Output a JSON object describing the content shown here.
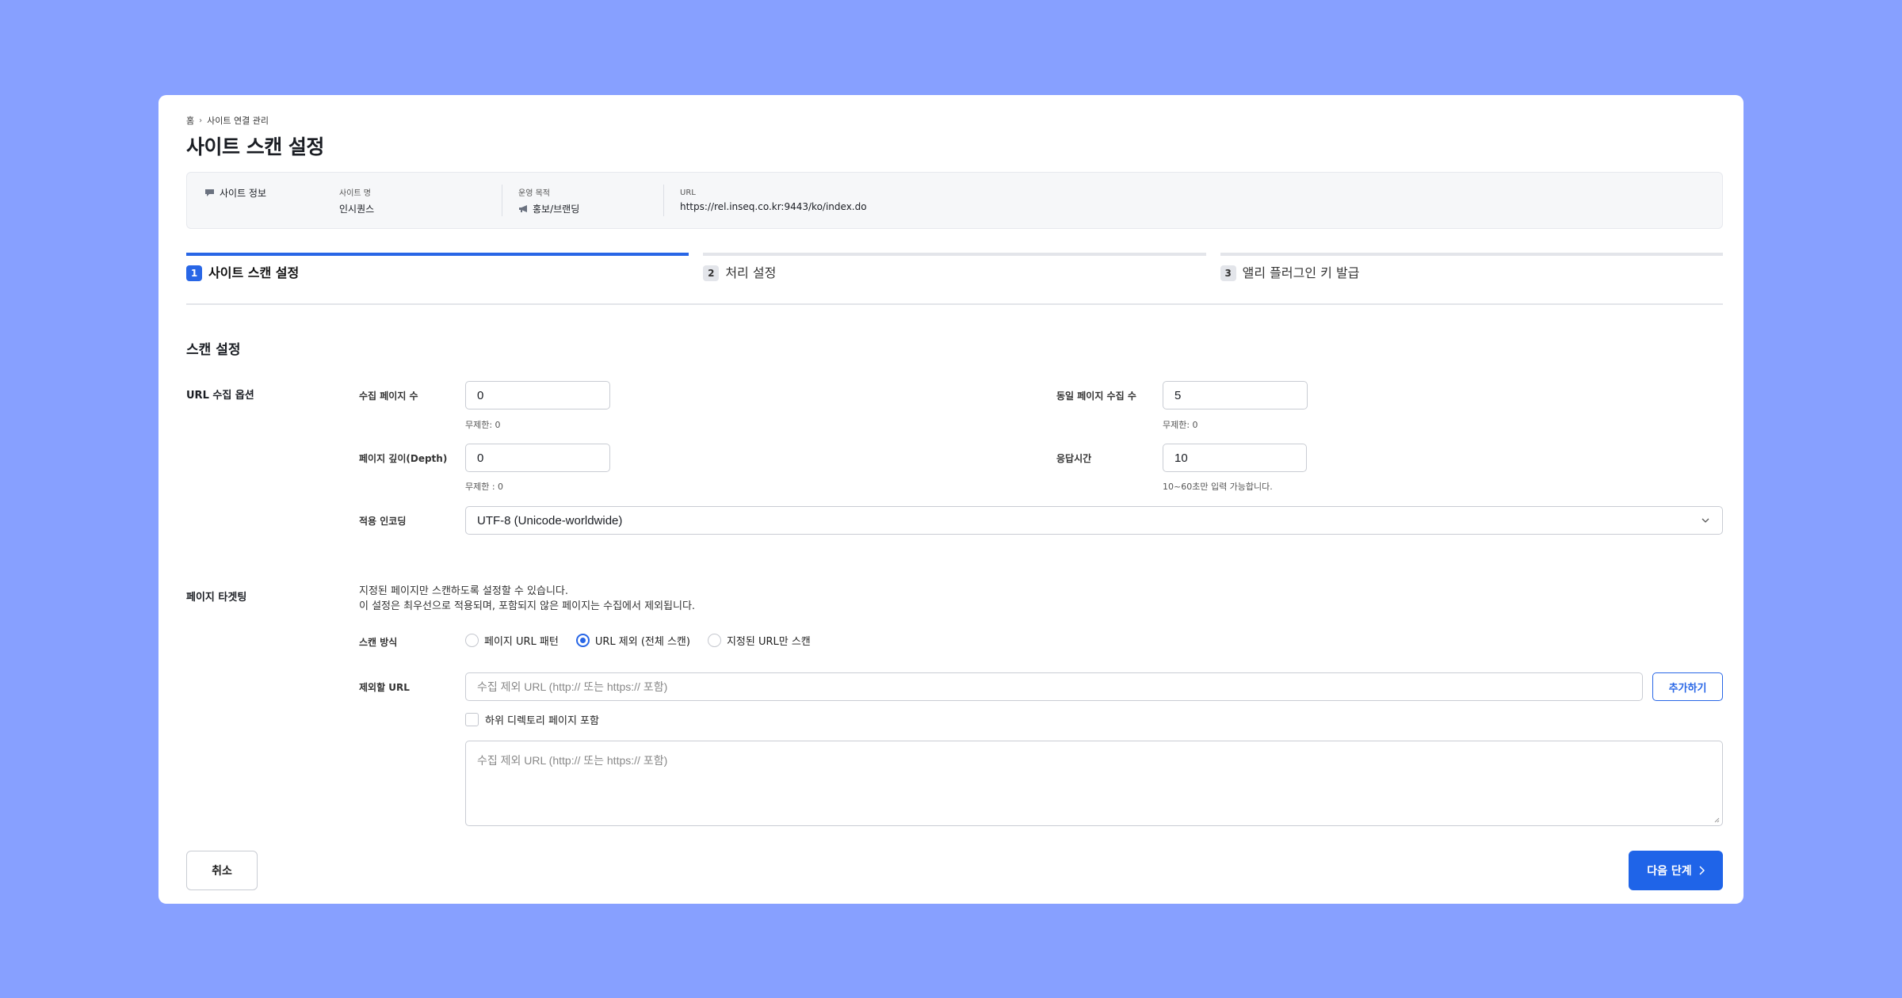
{
  "breadcrumb": {
    "home": "홈",
    "current": "사이트 연결 관리"
  },
  "page_title": "사이트 스캔 설정",
  "site_info": {
    "heading": "사이트 정보",
    "site_name_label": "사이트 명",
    "site_name": "인시퀀스",
    "purpose_label": "운영 목적",
    "purpose": "홍보/브랜딩",
    "url_label": "URL",
    "url": "https://rel.inseq.co.kr:9443/ko/index.do"
  },
  "steps": [
    {
      "num": "1",
      "label": "사이트 스캔 설정",
      "active": true
    },
    {
      "num": "2",
      "label": "처리 설정",
      "active": false
    },
    {
      "num": "3",
      "label": "앨리 플러그인 키 발급",
      "active": false
    }
  ],
  "scan_section_title": "스캔 설정",
  "url_options": {
    "group_label": "URL 수집 옵션",
    "collect_pages_label": "수집 페이지 수",
    "collect_pages_value": "0",
    "collect_pages_help": "무제한: 0",
    "same_page_label": "동일 페이지 수집 수",
    "same_page_value": "5",
    "same_page_help": "무제한: 0",
    "depth_label": "페이지 깊이(Depth)",
    "depth_value": "0",
    "depth_help": "무제한 : 0",
    "timeout_label": "응답시간",
    "timeout_value": "10",
    "timeout_help": "10~60초만 입력 가능합니다.",
    "encoding_label": "적용 인코딩",
    "encoding_value": "UTF-8 (Unicode-worldwide)"
  },
  "targeting": {
    "group_label": "페이지 타겟팅",
    "desc_line1": "지정된 페이지만 스캔하도록 설정할 수 있습니다.",
    "desc_line2": "이 설정은 최우선으로 적용되며, 포함되지 않은 페이지는 수집에서 제외됩니다.",
    "scan_mode_label": "스캔 방식",
    "modes": [
      {
        "label": "페이지 URL 패턴",
        "checked": false
      },
      {
        "label": "URL 제외 (전체 스캔)",
        "checked": true
      },
      {
        "label": "지정된 URL만 스캔",
        "checked": false
      }
    ],
    "exclude_url_label": "제외할 URL",
    "exclude_url_placeholder": "수집 제외 URL (http:// 또는 https:// 포함)",
    "add_button": "추가하기",
    "subdir_label": "하위 디렉토리 페이지 포함",
    "textarea_placeholder": "수집 제외 URL (http:// 또는 https:// 포함)"
  },
  "footer": {
    "cancel": "취소",
    "next": "다음 단계"
  },
  "colors": {
    "background": "#87a0ff",
    "primary": "#2866e6"
  }
}
